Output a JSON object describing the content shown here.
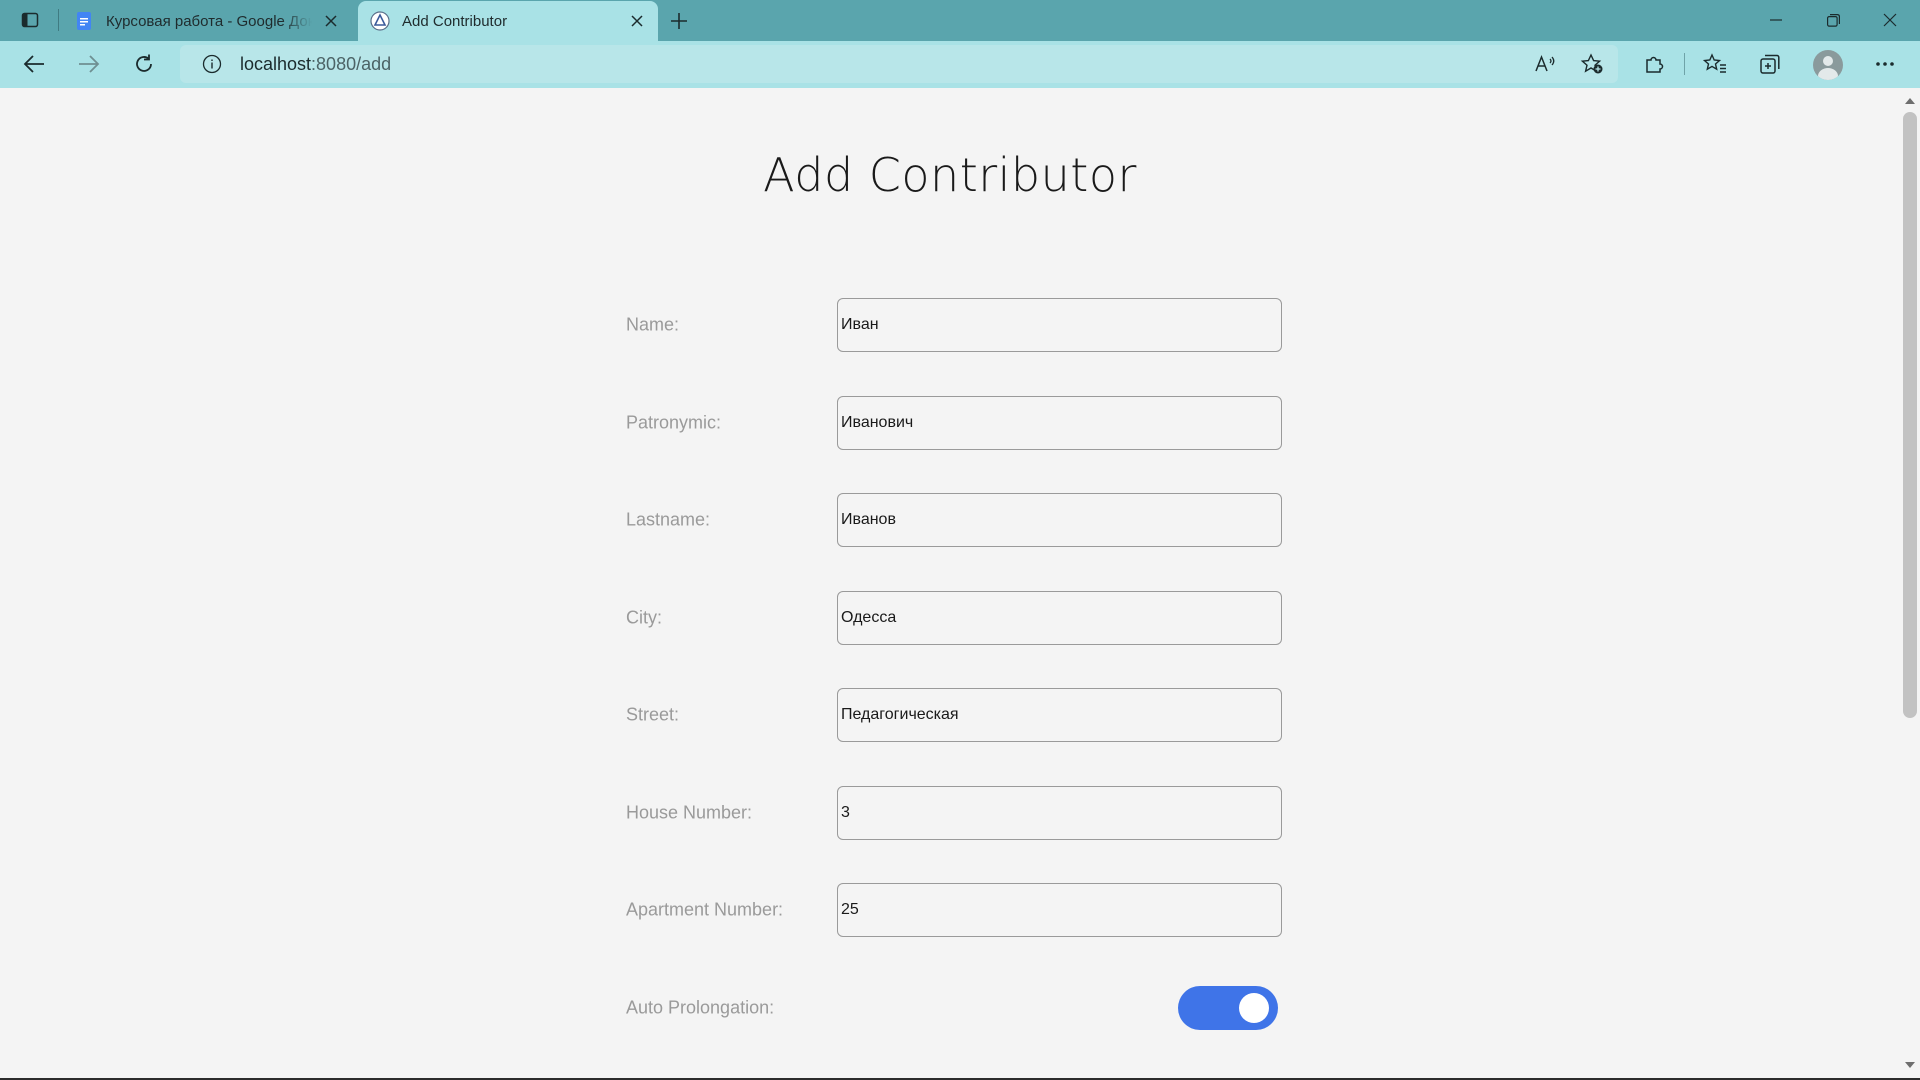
{
  "browser": {
    "tabs": [
      {
        "title": "Курсовая работа - Google Доку",
        "favicon": "google-docs-icon",
        "active": false
      },
      {
        "title": "Add Contributor",
        "favicon": "app-favicon-icon",
        "active": true
      }
    ],
    "address": {
      "host": "localhost",
      "path": ":8080/add"
    },
    "colors": {
      "tabstrip": "#5aa5ad",
      "toolbar": "#a9e2e6"
    }
  },
  "page": {
    "title": "Add Contributor",
    "fields": [
      {
        "label": "Name:",
        "value": "Иван"
      },
      {
        "label": "Patronymic:",
        "value": "Иванович"
      },
      {
        "label": "Lastname:",
        "value": "Иванов"
      },
      {
        "label": "City:",
        "value": "Одесса"
      },
      {
        "label": "Street:",
        "value": "Педагогическая"
      },
      {
        "label": "House Number:",
        "value": "3"
      },
      {
        "label": "Apartment Number:",
        "value": "25"
      }
    ],
    "toggle": {
      "label": "Auto Prolongation:",
      "state": "on",
      "color": "#3f74e8"
    }
  }
}
